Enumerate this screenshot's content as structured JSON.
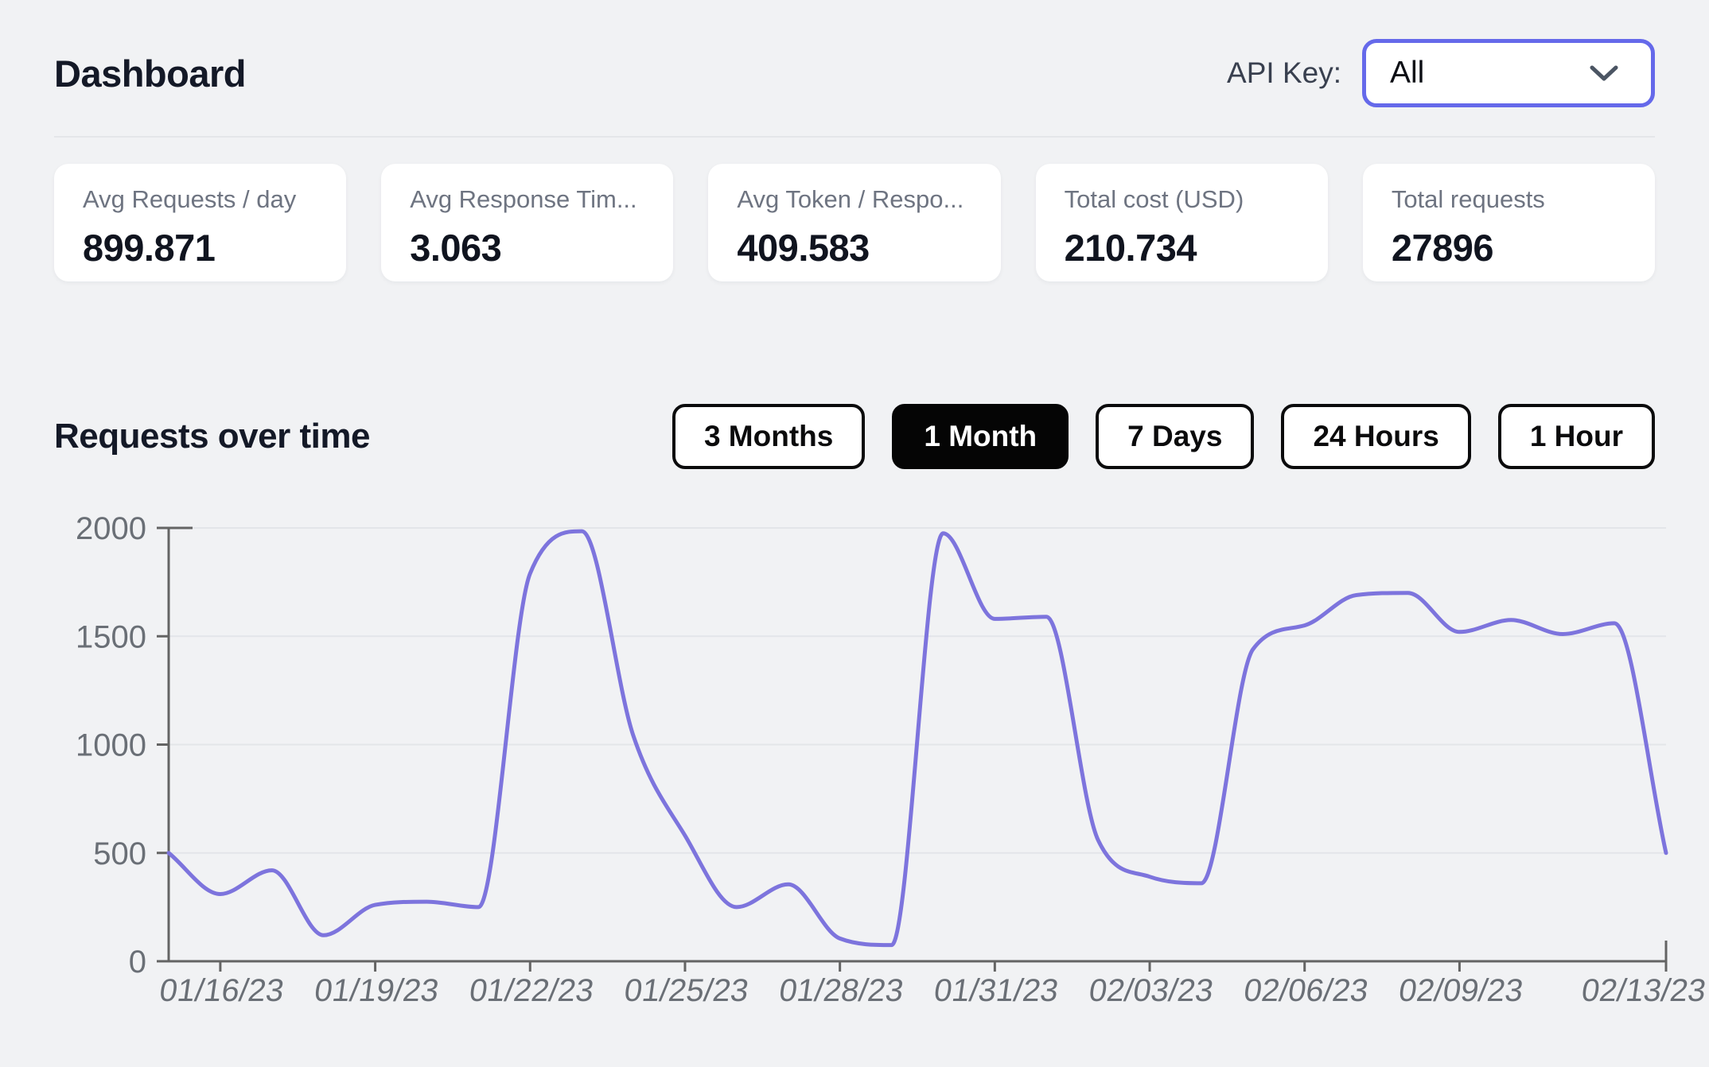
{
  "header": {
    "title": "Dashboard",
    "api_key_label": "API Key:",
    "api_key_value": "All"
  },
  "stats": [
    {
      "label": "Avg Requests / day",
      "value": "899.871"
    },
    {
      "label": "Avg Response Tim...",
      "value": "3.063"
    },
    {
      "label": "Avg Token / Respo...",
      "value": "409.583"
    },
    {
      "label": "Total cost (USD)",
      "value": "210.734"
    },
    {
      "label": "Total requests",
      "value": "27896"
    }
  ],
  "section": {
    "title": "Requests over time",
    "ranges": [
      {
        "label": "3 Months",
        "active": false
      },
      {
        "label": "1 Month",
        "active": true
      },
      {
        "label": "7 Days",
        "active": false
      },
      {
        "label": "24 Hours",
        "active": false
      },
      {
        "label": "1 Hour",
        "active": false
      }
    ]
  },
  "chart_data": {
    "type": "line",
    "title": "Requests over time",
    "x": [
      "01/15/23",
      "01/16/23",
      "01/17/23",
      "01/18/23",
      "01/19/23",
      "01/20/23",
      "01/21/23",
      "01/22/23",
      "01/23/23",
      "01/24/23",
      "01/25/23",
      "01/26/23",
      "01/27/23",
      "01/28/23",
      "01/29/23",
      "01/30/23",
      "01/31/23",
      "02/01/23",
      "02/02/23",
      "02/03/23",
      "02/04/23",
      "02/05/23",
      "02/06/23",
      "02/07/23",
      "02/08/23",
      "02/09/23",
      "02/10/23",
      "02/11/23",
      "02/12/23",
      "02/13/23"
    ],
    "values": [
      500,
      310,
      420,
      120,
      260,
      275,
      250,
      1790,
      1985,
      1040,
      580,
      250,
      355,
      105,
      75,
      1975,
      1580,
      1590,
      560,
      390,
      360,
      1440,
      1550,
      1690,
      1700,
      1520,
      1575,
      1510,
      1560,
      500
    ],
    "x_tick_labels": [
      "01/16/23",
      "01/19/23",
      "01/22/23",
      "01/25/23",
      "01/28/23",
      "01/31/23",
      "02/03/23",
      "02/06/23",
      "02/09/23",
      "02/13/23"
    ],
    "x_tick_indices": [
      1,
      4,
      7,
      10,
      13,
      16,
      19,
      22,
      25,
      29
    ],
    "y_ticks": [
      0,
      500,
      1000,
      1500,
      2000
    ],
    "ylim": [
      0,
      2000
    ],
    "xlabel": "",
    "ylabel": "",
    "legend": "none",
    "grid": "horizontal-only",
    "smoothing": "monotone",
    "line_color": "#7d74dd",
    "grid_color": "#e3e5e9",
    "axis_color": "#646464",
    "tick_text_color": "#6a6f76"
  }
}
